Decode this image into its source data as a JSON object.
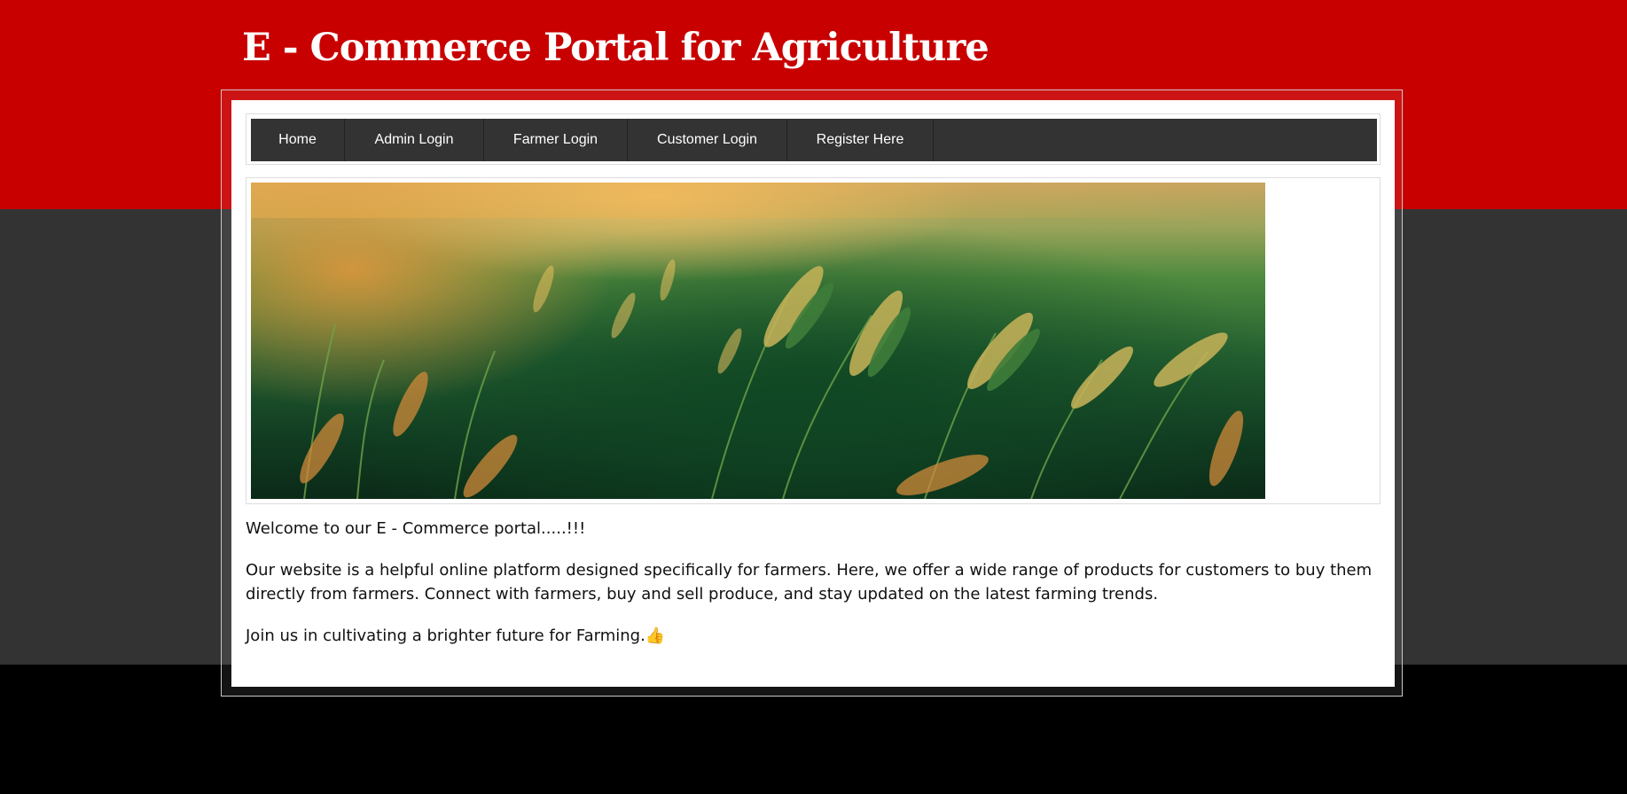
{
  "header": {
    "title": "E - Commerce Portal for Agriculture"
  },
  "nav": {
    "items": [
      {
        "label": "Home"
      },
      {
        "label": "Admin Login"
      },
      {
        "label": "Farmer Login"
      },
      {
        "label": "Customer Login"
      },
      {
        "label": "Register Here"
      }
    ]
  },
  "banner": {
    "description_icon": "wheat-field-image"
  },
  "content": {
    "welcome": "Welcome to our E - Commerce portal.....!!!",
    "about": "Our website is a helpful online platform designed specifically for farmers. Here, we offer a wide range of products for customers to buy them directly from farmers. Connect with farmers, buy and sell produce, and stay updated on the latest farming trends.",
    "join": "Join us in cultivating a brighter future for Farming.",
    "join_emoji": "👍"
  },
  "colors": {
    "header_red": "#c80000",
    "band_gray": "#333333",
    "nav_bg": "#333333",
    "nav_text": "#ffffff",
    "page_black": "#000000"
  }
}
